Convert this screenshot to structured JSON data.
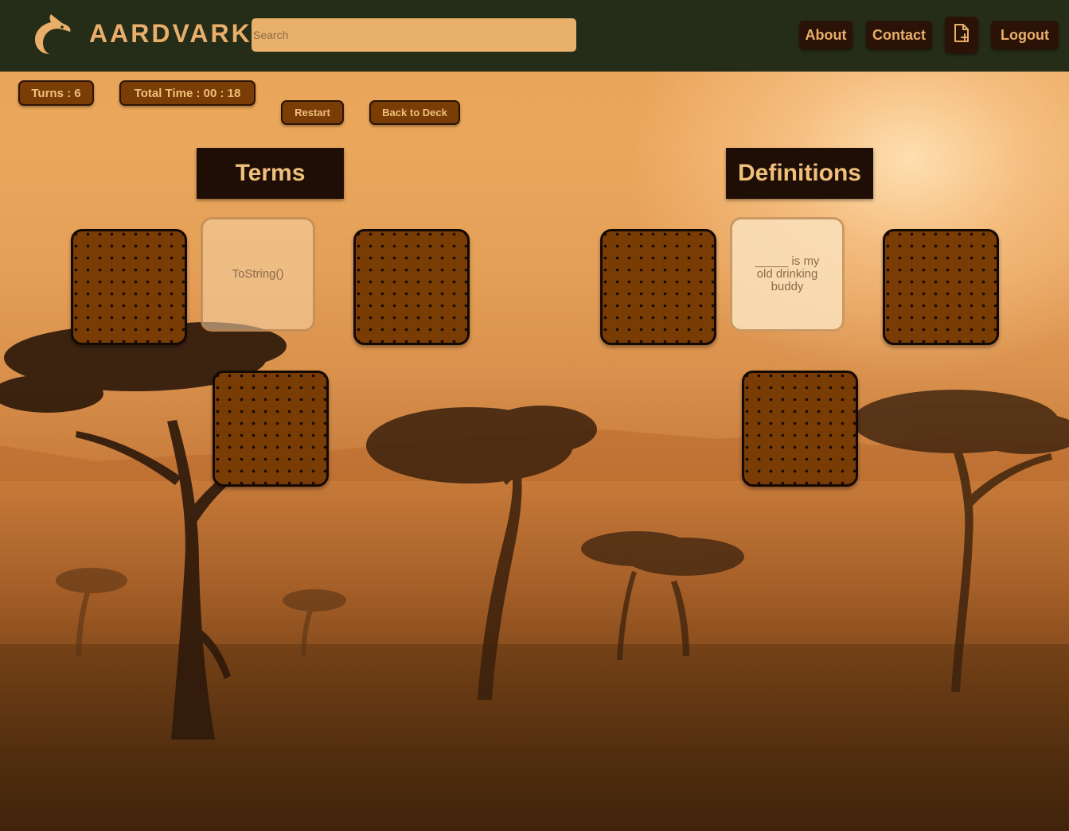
{
  "navbar": {
    "brand": "AARDVARK",
    "logo_icon": "aardvark-logo-icon",
    "search_placeholder": "Search",
    "about_label": "About",
    "contact_label": "Contact",
    "new_doc_icon": "file-plus-icon",
    "logout_label": "Logout"
  },
  "game": {
    "turns_text": "Turns : 6",
    "time_text": "Total Time : 00 : 18",
    "restart_label": "Restart",
    "back_label": "Back to Deck"
  },
  "terms": {
    "header": "Terms",
    "cards": [
      {
        "state": "hidden",
        "text": ""
      },
      {
        "state": "revealed",
        "text": "ToString()"
      },
      {
        "state": "hidden",
        "text": ""
      },
      {
        "state": "hidden",
        "text": ""
      }
    ]
  },
  "definitions": {
    "header": "Definitions",
    "cards": [
      {
        "state": "hidden",
        "text": ""
      },
      {
        "state": "revealed",
        "text": "_____ is my old drinking buddy"
      },
      {
        "state": "hidden",
        "text": ""
      },
      {
        "state": "hidden",
        "text": ""
      }
    ]
  },
  "colors": {
    "navbar": "#252c17",
    "accent": "#e9ae6a",
    "card_back": "#7a3c05",
    "header_bg": "#1f0e06"
  }
}
